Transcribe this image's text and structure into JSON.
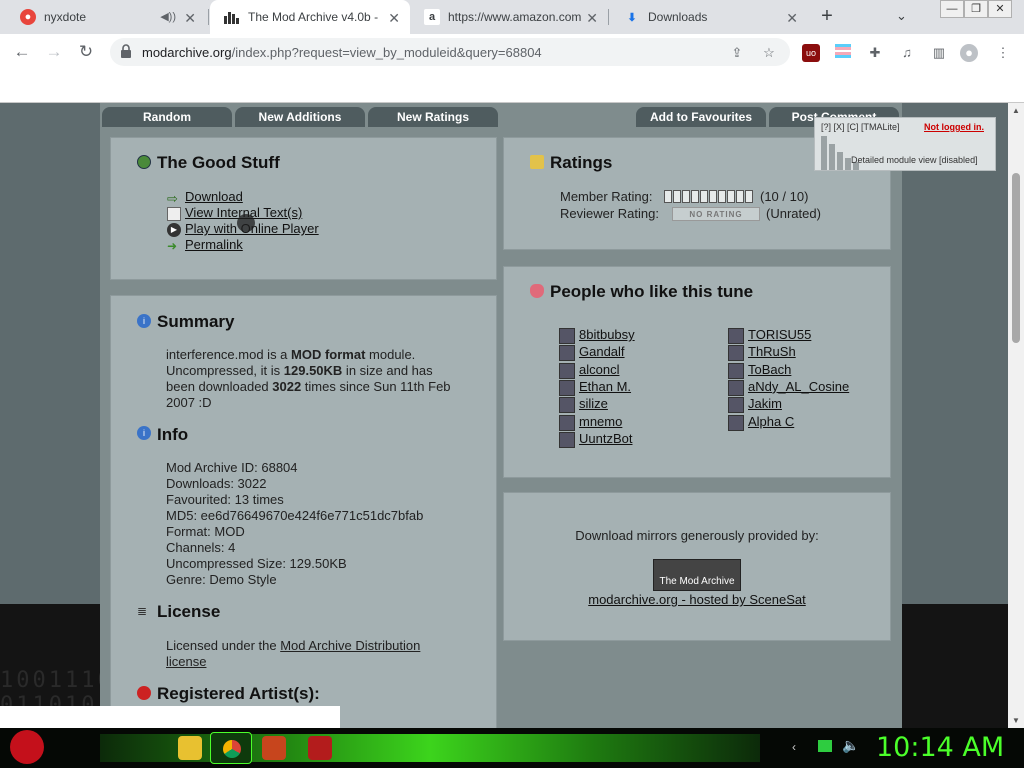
{
  "browser": {
    "tabs": [
      {
        "title": "nyxdote",
        "icon": "recording-icon"
      },
      {
        "title": "The Mod Archive v4.0b -",
        "icon": "modarchive-icon",
        "active": true
      },
      {
        "title": "https://www.amazon.com",
        "icon": "amazon-icon"
      },
      {
        "title": "Downloads",
        "icon": "download-icon"
      }
    ],
    "new_tab": "+",
    "tab_menu": "⌄",
    "url_domain": "modarchive.org",
    "url_path": "/index.php?request=view_by_moduleid&query=68804"
  },
  "site_nav": {
    "random": "Random",
    "new_additions": "New Additions",
    "new_ratings": "New Ratings",
    "add_to_favourites": "Add to Favourites",
    "post_comment": "Post Comment"
  },
  "notice": {
    "links": "[?] [X] [C] [TMALite]",
    "not_logged_in": "Not logged in.",
    "detail": "Detailed module view [disabled]"
  },
  "good_stuff": {
    "title": "The Good Stuff",
    "download": "Download",
    "view_internal": "View Internal Text(s)",
    "play_online": "Play with Online Player",
    "permalink": "Permalink"
  },
  "ratings": {
    "title": "Ratings",
    "member_label": "Member Rating:",
    "member_value": "(10 / 10)",
    "member_score": 10,
    "reviewer_label": "Reviewer Rating:",
    "reviewer_badge": "NO RATING",
    "reviewer_value": "(Unrated)"
  },
  "people": {
    "title": "People who like this tune",
    "left": [
      "8bitbubsy",
      "Gandalf",
      "alconcl",
      "Ethan M.",
      "silize",
      "mnemo",
      "UuntzBot"
    ],
    "right": [
      "TORISU55",
      "ThRuSh",
      "ToBach",
      "aNdy_AL_Cosine",
      "Jakim",
      "Alpha C"
    ]
  },
  "mirrors": {
    "text": "Download mirrors generously provided by:",
    "logo": "The Mod Archive",
    "link": "modarchive.org - hosted by SceneSat"
  },
  "summary": {
    "title": "Summary",
    "filename": "interference.mod",
    "t1": " is a ",
    "format": "MOD format",
    "t2": " module.",
    "t3": "Uncompressed, it is ",
    "size": "129.50KB",
    "t4": " in size and has",
    "t5": "been downloaded ",
    "downloads": "3022",
    "t6": " times since Sun 11th Feb",
    "t7": "2007 :D"
  },
  "info": {
    "title": "Info",
    "lines": [
      "Mod Archive ID: 68804",
      "Downloads: 3022",
      "Favourited: 13 times",
      "MD5: ee6d76649670e424f6e771c51dc7bfab",
      "Format: MOD",
      "Channels: 4",
      "Uncompressed Size: 129.50KB",
      "Genre: Demo Style"
    ]
  },
  "license": {
    "title": "License",
    "text": "Licensed under the ",
    "link1": "Mod Archive Distribution",
    "link2": "license"
  },
  "artists": {
    "title": "Registered Artist(s):"
  },
  "taskbar": {
    "clock": "10:14 AM"
  },
  "colors": {
    "page_bg": "#7f8c8d",
    "panel": "#a5b1b3",
    "nav_tab": "#4f5c5f",
    "clock": "#4bff2a",
    "alert": "#cc0000"
  }
}
